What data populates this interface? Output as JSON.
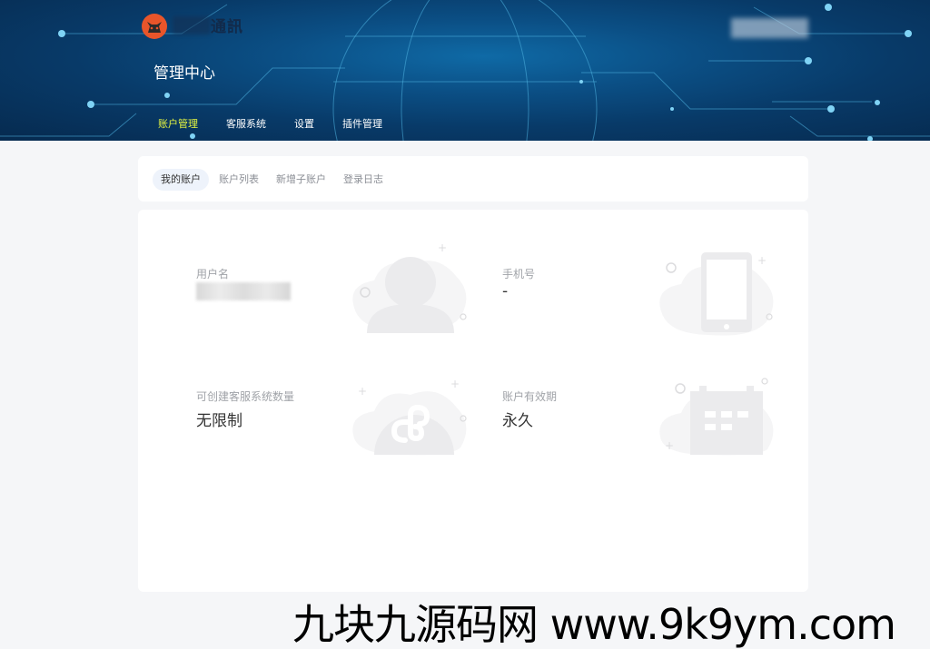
{
  "header": {
    "brand_text": "通訊",
    "title": "管理中心",
    "nav": [
      {
        "label": "账户管理",
        "active": true
      },
      {
        "label": "客服系统",
        "active": false
      },
      {
        "label": "设置",
        "active": false
      },
      {
        "label": "插件管理",
        "active": false
      }
    ]
  },
  "tabs": [
    {
      "label": "我的账户",
      "active": true
    },
    {
      "label": "账户列表",
      "active": false
    },
    {
      "label": "新增子账户",
      "active": false
    },
    {
      "label": "登录日志",
      "active": false
    }
  ],
  "account": {
    "username_label": "用户名",
    "phone_label": "手机号",
    "phone_value": "-",
    "quota_label": "可创建客服系统数量",
    "quota_value": "无限制",
    "validity_label": "账户有效期",
    "validity_value": "永久"
  },
  "watermark": "九块九源码网 www.9k9ym.com",
  "colors": {
    "nav_active": "#e5f540",
    "banner": "#0b4f85",
    "accent_orange": "#e8552a"
  },
  "icons": [
    "logo-icon",
    "user-illustration-icon",
    "phone-illustration-icon",
    "miniprogram-illustration-icon",
    "calendar-illustration-icon"
  ]
}
